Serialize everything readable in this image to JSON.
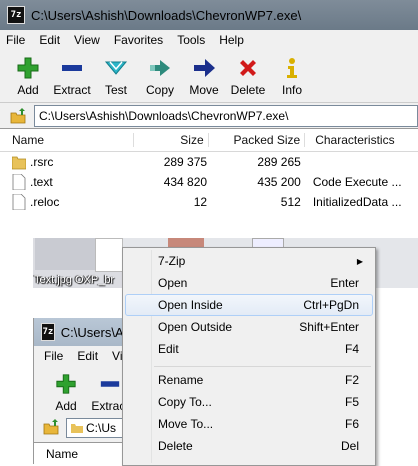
{
  "window1": {
    "title": "C:\\Users\\Ashish\\Downloads\\ChevronWP7.exe\\",
    "app_icon": "7z",
    "menus": [
      "File",
      "Edit",
      "View",
      "Favorites",
      "Tools",
      "Help"
    ],
    "toolbar": [
      {
        "label": "Add",
        "icon": "plus-icon",
        "color": "#2fa12f"
      },
      {
        "label": "Extract",
        "icon": "minus-icon",
        "color": "#1b3a9c"
      },
      {
        "label": "Test",
        "icon": "check-chevron-icon",
        "color": "#2bb5c8"
      },
      {
        "label": "Copy",
        "icon": "double-arrow-icon",
        "color": "#2d8a7c"
      },
      {
        "label": "Move",
        "icon": "arrow-right-icon",
        "color": "#1b2f8c"
      },
      {
        "label": "Delete",
        "icon": "x-icon",
        "color": "#d11a1a"
      },
      {
        "label": "Info",
        "icon": "info-icon",
        "color": "#d9b000"
      }
    ],
    "address": "C:\\Users\\Ashish\\Downloads\\ChevronWP7.exe\\",
    "columns": {
      "name": "Name",
      "size": "Size",
      "packed": "Packed Size",
      "char": "Characteristics"
    },
    "files": [
      {
        "name": ".rsrc",
        "size": "289 375",
        "packed": "289 265",
        "char": "",
        "type": "folder"
      },
      {
        "name": ".text",
        "size": "434 820",
        "packed": "435 200",
        "char": "Code Execute ...",
        "type": "file"
      },
      {
        "name": ".reloc",
        "size": "12",
        "packed": "512",
        "char": "InitializedData ...",
        "type": "file"
      }
    ]
  },
  "desktop": {
    "label": "Text.jpg  OXP_br"
  },
  "window2": {
    "title": "C:\\Users\\Ashish",
    "app_icon": "7z",
    "menus": [
      "File",
      "Edit",
      "Vi"
    ],
    "toolbar": [
      {
        "label": "Add",
        "icon": "plus-icon"
      },
      {
        "label": "Extract",
        "icon": "minus-icon"
      }
    ],
    "address": "C:\\Us",
    "column": "Name"
  },
  "context_menu": {
    "items": [
      {
        "label": "7-Zip",
        "key": "",
        "submenu": true
      },
      {
        "label": "Open",
        "key": "Enter"
      },
      {
        "label": "Open Inside",
        "key": "Ctrl+PgDn",
        "highlighted": true
      },
      {
        "label": "Open Outside",
        "key": "Shift+Enter"
      },
      {
        "label": "Edit",
        "key": "F4"
      },
      {
        "label": "Rename",
        "key": "F2"
      },
      {
        "label": "Copy To...",
        "key": "F5"
      },
      {
        "label": "Move To...",
        "key": "F6"
      },
      {
        "label": "Delete",
        "key": "Del"
      }
    ]
  }
}
